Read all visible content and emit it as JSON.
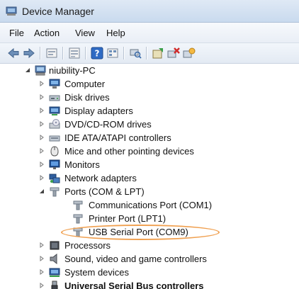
{
  "window": {
    "title": "Device Manager",
    "accent": "#c9daee",
    "highlight_color": "#f0a050"
  },
  "menu": [
    "File",
    "Action",
    "View",
    "Help"
  ],
  "toolbar": [
    "back-icon",
    "forward-icon",
    "up-icon",
    "properties-icon",
    "help-icon",
    "view-icon",
    "scan-icon",
    "update-driver-icon",
    "uninstall-icon",
    "disable-icon"
  ],
  "tree": {
    "root": "niubility-PC",
    "items": [
      {
        "label": "Computer",
        "icon": "computer-icon"
      },
      {
        "label": "Disk drives",
        "icon": "disk-drive-icon"
      },
      {
        "label": "Display adapters",
        "icon": "display-adapter-icon"
      },
      {
        "label": "DVD/CD-ROM drives",
        "icon": "dvd-drive-icon"
      },
      {
        "label": "IDE ATA/ATAPI controllers",
        "icon": "ide-controller-icon"
      },
      {
        "label": "Mice and other pointing devices",
        "icon": "mouse-icon"
      },
      {
        "label": "Monitors",
        "icon": "monitor-icon"
      },
      {
        "label": "Network adapters",
        "icon": "network-adapter-icon"
      },
      {
        "label": "Ports (COM & LPT)",
        "icon": "port-icon",
        "expanded": true,
        "children": [
          {
            "label": "Communications Port (COM1)",
            "icon": "port-icon"
          },
          {
            "label": "Printer Port (LPT1)",
            "icon": "port-icon"
          },
          {
            "label": "USB Serial Port (COM9)",
            "icon": "port-icon",
            "highlighted": true
          }
        ]
      },
      {
        "label": "Processors",
        "icon": "processor-icon"
      },
      {
        "label": "Sound, video and game controllers",
        "icon": "speaker-icon"
      },
      {
        "label": "System devices",
        "icon": "system-devices-icon"
      },
      {
        "label": "Universal Serial Bus controllers",
        "icon": "usb-icon"
      }
    ]
  }
}
